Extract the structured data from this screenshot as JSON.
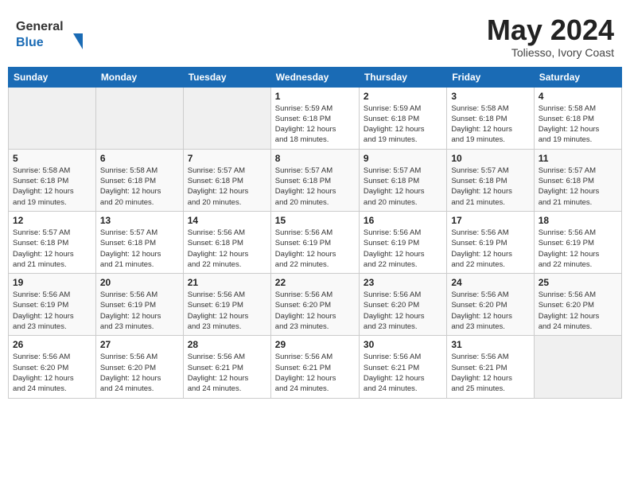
{
  "header": {
    "logo_general": "General",
    "logo_blue": "Blue",
    "title": "May 2024",
    "location": "Toliesso, Ivory Coast"
  },
  "calendar": {
    "weekdays": [
      "Sunday",
      "Monday",
      "Tuesday",
      "Wednesday",
      "Thursday",
      "Friday",
      "Saturday"
    ],
    "weeks": [
      [
        {
          "day": "",
          "info": ""
        },
        {
          "day": "",
          "info": ""
        },
        {
          "day": "",
          "info": ""
        },
        {
          "day": "1",
          "info": "Sunrise: 5:59 AM\nSunset: 6:18 PM\nDaylight: 12 hours\nand 18 minutes."
        },
        {
          "day": "2",
          "info": "Sunrise: 5:59 AM\nSunset: 6:18 PM\nDaylight: 12 hours\nand 19 minutes."
        },
        {
          "day": "3",
          "info": "Sunrise: 5:58 AM\nSunset: 6:18 PM\nDaylight: 12 hours\nand 19 minutes."
        },
        {
          "day": "4",
          "info": "Sunrise: 5:58 AM\nSunset: 6:18 PM\nDaylight: 12 hours\nand 19 minutes."
        }
      ],
      [
        {
          "day": "5",
          "info": "Sunrise: 5:58 AM\nSunset: 6:18 PM\nDaylight: 12 hours\nand 19 minutes."
        },
        {
          "day": "6",
          "info": "Sunrise: 5:58 AM\nSunset: 6:18 PM\nDaylight: 12 hours\nand 20 minutes."
        },
        {
          "day": "7",
          "info": "Sunrise: 5:57 AM\nSunset: 6:18 PM\nDaylight: 12 hours\nand 20 minutes."
        },
        {
          "day": "8",
          "info": "Sunrise: 5:57 AM\nSunset: 6:18 PM\nDaylight: 12 hours\nand 20 minutes."
        },
        {
          "day": "9",
          "info": "Sunrise: 5:57 AM\nSunset: 6:18 PM\nDaylight: 12 hours\nand 20 minutes."
        },
        {
          "day": "10",
          "info": "Sunrise: 5:57 AM\nSunset: 6:18 PM\nDaylight: 12 hours\nand 21 minutes."
        },
        {
          "day": "11",
          "info": "Sunrise: 5:57 AM\nSunset: 6:18 PM\nDaylight: 12 hours\nand 21 minutes."
        }
      ],
      [
        {
          "day": "12",
          "info": "Sunrise: 5:57 AM\nSunset: 6:18 PM\nDaylight: 12 hours\nand 21 minutes."
        },
        {
          "day": "13",
          "info": "Sunrise: 5:57 AM\nSunset: 6:18 PM\nDaylight: 12 hours\nand 21 minutes."
        },
        {
          "day": "14",
          "info": "Sunrise: 5:56 AM\nSunset: 6:18 PM\nDaylight: 12 hours\nand 22 minutes."
        },
        {
          "day": "15",
          "info": "Sunrise: 5:56 AM\nSunset: 6:19 PM\nDaylight: 12 hours\nand 22 minutes."
        },
        {
          "day": "16",
          "info": "Sunrise: 5:56 AM\nSunset: 6:19 PM\nDaylight: 12 hours\nand 22 minutes."
        },
        {
          "day": "17",
          "info": "Sunrise: 5:56 AM\nSunset: 6:19 PM\nDaylight: 12 hours\nand 22 minutes."
        },
        {
          "day": "18",
          "info": "Sunrise: 5:56 AM\nSunset: 6:19 PM\nDaylight: 12 hours\nand 22 minutes."
        }
      ],
      [
        {
          "day": "19",
          "info": "Sunrise: 5:56 AM\nSunset: 6:19 PM\nDaylight: 12 hours\nand 23 minutes."
        },
        {
          "day": "20",
          "info": "Sunrise: 5:56 AM\nSunset: 6:19 PM\nDaylight: 12 hours\nand 23 minutes."
        },
        {
          "day": "21",
          "info": "Sunrise: 5:56 AM\nSunset: 6:19 PM\nDaylight: 12 hours\nand 23 minutes."
        },
        {
          "day": "22",
          "info": "Sunrise: 5:56 AM\nSunset: 6:20 PM\nDaylight: 12 hours\nand 23 minutes."
        },
        {
          "day": "23",
          "info": "Sunrise: 5:56 AM\nSunset: 6:20 PM\nDaylight: 12 hours\nand 23 minutes."
        },
        {
          "day": "24",
          "info": "Sunrise: 5:56 AM\nSunset: 6:20 PM\nDaylight: 12 hours\nand 23 minutes."
        },
        {
          "day": "25",
          "info": "Sunrise: 5:56 AM\nSunset: 6:20 PM\nDaylight: 12 hours\nand 24 minutes."
        }
      ],
      [
        {
          "day": "26",
          "info": "Sunrise: 5:56 AM\nSunset: 6:20 PM\nDaylight: 12 hours\nand 24 minutes."
        },
        {
          "day": "27",
          "info": "Sunrise: 5:56 AM\nSunset: 6:20 PM\nDaylight: 12 hours\nand 24 minutes."
        },
        {
          "day": "28",
          "info": "Sunrise: 5:56 AM\nSunset: 6:21 PM\nDaylight: 12 hours\nand 24 minutes."
        },
        {
          "day": "29",
          "info": "Sunrise: 5:56 AM\nSunset: 6:21 PM\nDaylight: 12 hours\nand 24 minutes."
        },
        {
          "day": "30",
          "info": "Sunrise: 5:56 AM\nSunset: 6:21 PM\nDaylight: 12 hours\nand 24 minutes."
        },
        {
          "day": "31",
          "info": "Sunrise: 5:56 AM\nSunset: 6:21 PM\nDaylight: 12 hours\nand 25 minutes."
        },
        {
          "day": "",
          "info": ""
        }
      ]
    ]
  }
}
